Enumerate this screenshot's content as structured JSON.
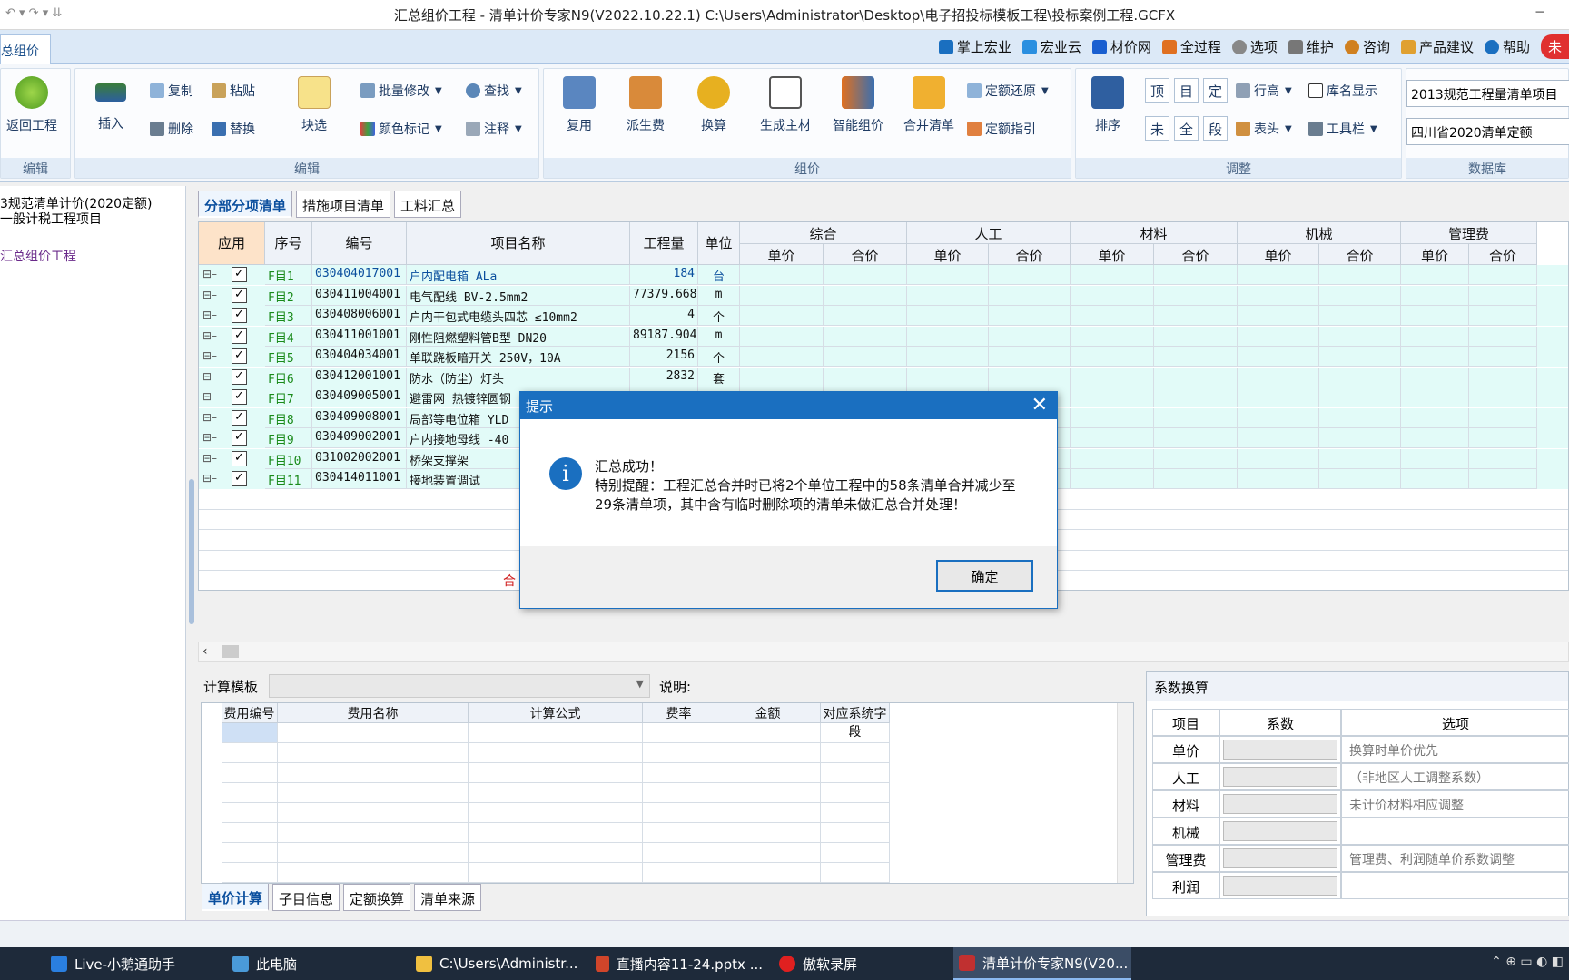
{
  "window": {
    "title": "汇总组价工程 - 清单计价专家N9(V2022.10.22.1) C:\\Users\\Administrator\\Desktop\\电子招投标模板工程\\投标案例工程.GCFX",
    "minimize": "─"
  },
  "menubar": {
    "file_tab": "总组价",
    "links": [
      "掌上宏业",
      "宏业云",
      "材价网",
      "全过程",
      "选项",
      "维护",
      "咨询",
      "产品建议",
      "帮助"
    ],
    "last_link": "未"
  },
  "ribbon": {
    "groups": {
      "g1": "编辑",
      "g2": "编辑",
      "g3": "组价",
      "g4": "调整",
      "g5": "数据库"
    },
    "buttons": {
      "back": "返回工程",
      "insert": "插入",
      "copy": "复制",
      "paste": "粘贴",
      "delete": "删除",
      "replace": "替换",
      "block": "块选",
      "batch_edit": "批量修改",
      "find": "查找",
      "color_mark": "颜色标记",
      "note": "注释",
      "reuse": "复用",
      "derive_fee": "派生费",
      "convert": "换算",
      "gen_main": "生成主材",
      "smart_price": "智能组价",
      "merge": "合并清单",
      "quota_restore": "定额还原",
      "quota_guide": "定额指引",
      "sort": "排序",
      "row_height": "行高",
      "lib_display": "库名显示",
      "header": "表头",
      "toolbar": "工具栏",
      "sq1": "顶",
      "sq2": "目",
      "sq3": "定",
      "sq4": "未",
      "sq5": "全",
      "sq6": "段"
    },
    "db1": "2013规范工程量清单项目",
    "db2": "四川省2020清单定额"
  },
  "left_panel": {
    "line1": "3规范清单计价(2020定额)",
    "line2": "一般计税工程项目",
    "project": "汇总组价工程"
  },
  "main_tabs": [
    "分部分项清单",
    "措施项目清单",
    "工料汇总"
  ],
  "grid": {
    "headers": {
      "apply": "应用",
      "seq": "序号",
      "code": "编号",
      "name": "项目名称",
      "qty": "工程量",
      "unit": "单位",
      "groups": [
        "综合",
        "人工",
        "材料",
        "机械",
        "管理费"
      ],
      "unit_price": "单价",
      "total": "合价"
    },
    "rows": [
      {
        "seq": "F目1",
        "code": "030404017001",
        "name": "户内配电箱 ALa",
        "qty": "184",
        "unit": "台"
      },
      {
        "seq": "F目2",
        "code": "030411004001",
        "name": "电气配线 BV-2.5mm2",
        "qty": "77379.668",
        "unit": "m"
      },
      {
        "seq": "F目3",
        "code": "030408006001",
        "name": "户内干包式电缆头四芯 ≤10mm2",
        "qty": "4",
        "unit": "个"
      },
      {
        "seq": "F目4",
        "code": "030411001001",
        "name": "刚性阻燃塑料管B型 DN20",
        "qty": "89187.904",
        "unit": "m"
      },
      {
        "seq": "F目5",
        "code": "030404034001",
        "name": "单联跷板暗开关 250V，10A",
        "qty": "2156",
        "unit": "个"
      },
      {
        "seq": "F目6",
        "code": "030412001001",
        "name": "防水（防尘）灯头",
        "qty": "2832",
        "unit": "套"
      },
      {
        "seq": "F目7",
        "code": "030409005001",
        "name": "避雷网 热镀锌圆钢",
        "qty": "",
        "unit": ""
      },
      {
        "seq": "F目8",
        "code": "030409008001",
        "name": "局部等电位箱 YLD",
        "qty": "",
        "unit": ""
      },
      {
        "seq": "F目9",
        "code": "030409002001",
        "name": "户内接地母线 -40",
        "qty": "",
        "unit": ""
      },
      {
        "seq": "F目10",
        "code": "031002002001",
        "name": "桥架支撑架",
        "qty": "",
        "unit": ""
      },
      {
        "seq": "F目11",
        "code": "030414011001",
        "name": "接地装置调试",
        "qty": "",
        "unit": ""
      }
    ],
    "total_label": "合"
  },
  "dialog": {
    "title": "提示",
    "line1": "汇总成功！",
    "line2": "特别提醒：工程汇总合并时已将2个单位工程中的58条清单合并减少至",
    "line3": "29条清单项，其中含有临时删除项的清单未做汇总合并处理！",
    "ok": "确定",
    "close": "✕"
  },
  "calc": {
    "template_label": "计算模板",
    "desc_label": "说明:",
    "headers": [
      "费用编号",
      "费用名称",
      "计算公式",
      "费率",
      "金额",
      "对应系统字段"
    ]
  },
  "bottom_tabs": [
    "单价计算",
    "子目信息",
    "定额换算",
    "清单来源"
  ],
  "coef": {
    "title": "系数换算",
    "headers": [
      "项目",
      "系数",
      "选项"
    ],
    "rows": [
      {
        "label": "单价",
        "option": "换算时单价优先"
      },
      {
        "label": "人工",
        "option": "（非地区人工调整系数）"
      },
      {
        "label": "材料",
        "option": "未计价材料相应调整"
      },
      {
        "label": "机械",
        "option": ""
      },
      {
        "label": "管理费",
        "option": "管理费、利润随单价系数调整"
      },
      {
        "label": "利润",
        "option": ""
      }
    ]
  },
  "taskbar": {
    "items": [
      "Live-小鹅通助手",
      "此电脑",
      "C:\\Users\\Administr...",
      "直播内容11-24.pptx ...",
      "傲软录屏",
      "清单计价专家N9(V20..."
    ]
  },
  "colors": {
    "accent": "#1a6fc0",
    "row_bg": "#e2fbf8",
    "seq_green": "#1a8a1a",
    "link_blue": "#0b4f9e"
  }
}
